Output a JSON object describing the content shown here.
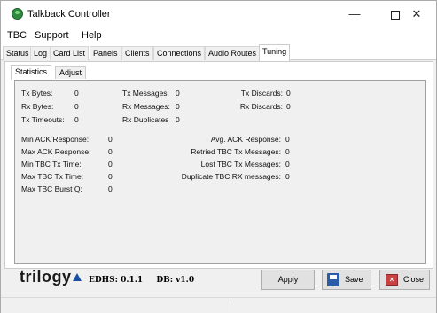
{
  "window": {
    "title": "Talkback Controller",
    "controls": {
      "minimize": "—",
      "maximize": "",
      "close": "✕"
    }
  },
  "menu": [
    "TBC",
    "Support",
    "Help"
  ],
  "tabs": [
    "Status",
    "Log",
    "Card List",
    "Panels",
    "Clients",
    "Connections",
    "Audio Routes",
    "Tuning"
  ],
  "active_tab": "Tuning",
  "subtabs": [
    "Statistics",
    "Adjust"
  ],
  "active_subtab": "Statistics",
  "stats": {
    "tx_bytes": {
      "label": "Tx Bytes:",
      "value": "0"
    },
    "rx_bytes": {
      "label": "Rx Bytes:",
      "value": "0"
    },
    "tx_timeouts": {
      "label": "Tx Timeouts:",
      "value": "0"
    },
    "tx_messages": {
      "label": "Tx Messages:",
      "value": "0"
    },
    "rx_messages": {
      "label": "Rx Messages:",
      "value": "0"
    },
    "rx_duplicates": {
      "label": "Rx Duplicates",
      "value": "0"
    },
    "tx_discards": {
      "label": "Tx Discards:",
      "value": "0"
    },
    "rx_discards": {
      "label": "Rx Discards:",
      "value": "0"
    },
    "min_ack": {
      "label": "Min ACK Response:",
      "value": "0"
    },
    "max_ack": {
      "label": "Max ACK Response:",
      "value": "0"
    },
    "min_tbc_tx": {
      "label": "Min TBC Tx Time:",
      "value": "0"
    },
    "max_tbc_tx": {
      "label": "Max TBC Tx Time:",
      "value": "0"
    },
    "max_tbc_burst": {
      "label": "Max TBC Burst Q:",
      "value": "0"
    },
    "avg_ack": {
      "label": "Avg. ACK Response:",
      "value": "0"
    },
    "retried_tbc": {
      "label": "Retried TBC Tx Messages:",
      "value": "0"
    },
    "lost_tbc": {
      "label": "Lost TBC Tx Messages:",
      "value": "0"
    },
    "dup_tbc_rx": {
      "label": "Duplicate TBC RX messages:",
      "value": "0"
    }
  },
  "footer": {
    "logo": "trilogy",
    "edhs": "EDHS: 0.1.1",
    "db": "DB: v1.0"
  },
  "buttons": {
    "apply": "Apply",
    "save": "Save",
    "close": "Close"
  },
  "colors": {
    "accent": "#1b4f9c",
    "close_icon": "#c94040",
    "save_icon": "#2a5ca8"
  }
}
